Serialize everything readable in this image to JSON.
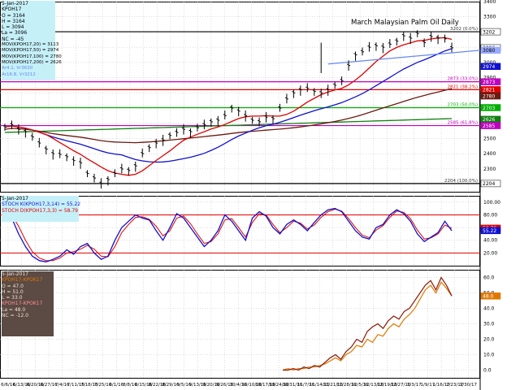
{
  "title": "March Malaysian Palm Oil Daily",
  "panel1": {
    "date": "5-Jan-2017",
    "symbol": "KPOH17",
    "open": "O = 3164",
    "high": "H = 3164",
    "low": "L = 3094",
    "last": "La = 3096",
    "net_change": "NC = -45",
    "ma_legend": [
      {
        "text": "MOV(KPOH17,20) = 3113",
        "color": "#e00000"
      },
      {
        "text": "MOV(KPOH17,50) = 2974",
        "color": "#1010d0"
      },
      {
        "text": "MOV(KPOH17,100) = 2780",
        "color": "#6b1a10"
      },
      {
        "text": "MOV(KPOH17,200) = 2626",
        "color": "#108010"
      }
    ],
    "extra_lines": [
      "Ar4.1, Vr3630",
      "Ar16.8, Vr3212"
    ]
  },
  "panel2": {
    "date": "5-Jan-2017",
    "stoch_k": "STOCH K(KPOH17,3,14) = 55.22",
    "stoch_d": "STOCH D(KPOH17,3,3) = 58.79"
  },
  "panel3": {
    "date": "5-Jan-2017",
    "lines": [
      "KPOH17-KPOK17",
      "O = 47.0",
      "H = 51.0",
      "L = 33.0",
      "KPOH17-KPOK17",
      "La = 48.0",
      "NC = -12.0"
    ]
  },
  "colors": {
    "ma20": "#e00000",
    "ma50": "#1010d0",
    "ma100": "#6b1a10",
    "ma200": "#108010",
    "stoch_k": "#1010d0",
    "stoch_d": "#e00000",
    "spread1": "#8b1a0a",
    "spread2": "#e07800",
    "trend": "#6688ee",
    "fib_magenta": "#c000c0",
    "fib_red": "#e00000",
    "fib_green": "#00b000"
  },
  "chart_data": [
    {
      "type": "line",
      "title": "March Malaysian Palm Oil Daily",
      "ylim": [
        2150,
        3400
      ],
      "y_ticks": [
        2200,
        2300,
        2400,
        2500,
        2600,
        2700,
        2800,
        2900,
        3000,
        3100,
        3200,
        3300,
        3400
      ],
      "x_labels": [
        "6/6/16",
        "6/13/16",
        "6/20/16",
        "6/27/16",
        "7/4/16",
        "7/11/16",
        "7/18/16",
        "7/25/16",
        "8/1/16",
        "8/8/16",
        "8/15/16",
        "8/22/16",
        "8/29/16",
        "9/5/16",
        "9/13/16",
        "9/20/16",
        "9/26/16",
        "10/4/16",
        "10/10/16",
        "10/17/16",
        "10/24/16",
        "10/31/16",
        "11/7/16",
        "11/14/16",
        "11/21/16",
        "11/28/16",
        "12/5/16",
        "12/13/16",
        "12/19/16",
        "12/27/16",
        "1/3/17",
        "1/9/17",
        "1/16/17",
        "1/23/17",
        "1/30/17"
      ],
      "price_close": [
        2575,
        2590,
        2560,
        2545,
        2510,
        2470,
        2430,
        2400,
        2395,
        2380,
        2355,
        2340,
        2270,
        2240,
        2205,
        2230,
        2270,
        2300,
        2290,
        2320,
        2400,
        2440,
        2470,
        2490,
        2520,
        2540,
        2560,
        2545,
        2570,
        2590,
        2610,
        2620,
        2650,
        2700,
        2680,
        2650,
        2620,
        2610,
        2640,
        2630,
        2700,
        2760,
        2800,
        2820,
        2830,
        2810,
        2800,
        2820,
        2850,
        2880,
        2980,
        3050,
        3070,
        3100,
        3110,
        3100,
        3120,
        3140,
        3175,
        3160,
        3190,
        3130,
        3170,
        3160,
        3155,
        3096
      ],
      "overlay_labels": [
        {
          "y": 3202,
          "text": "3202 (0.0%)"
        },
        {
          "y": 2873,
          "text": "2873 (33.0%)"
        },
        {
          "y": 2821,
          "text": "2821 (38.2%)"
        },
        {
          "y": 2703,
          "text": "2703 (50.0%)"
        },
        {
          "y": 2585,
          "text": "2585 (61.8%)"
        },
        {
          "y": 2204,
          "text": "2204 (100.0%)"
        }
      ],
      "value_badges": [
        {
          "y": 3202,
          "text": "3202",
          "bg": "#ffffff",
          "fg": "#000"
        },
        {
          "y": 3096,
          "text": "3096",
          "bg": "#ffffff",
          "fg": "#000"
        },
        {
          "y": 3080,
          "text": "3080",
          "bg": "#99aaff",
          "fg": "#000"
        },
        {
          "y": 2974,
          "text": "2974",
          "bg": "#1010d0",
          "fg": "#fff"
        },
        {
          "y": 2873,
          "text": "2873",
          "bg": "#c000c0",
          "fg": "#fff"
        },
        {
          "y": 2821,
          "text": "2821",
          "bg": "#e00000",
          "fg": "#fff"
        },
        {
          "y": 2780,
          "text": "2780",
          "bg": "#6b1a10",
          "fg": "#fff"
        },
        {
          "y": 2703,
          "text": "2703",
          "bg": "#00b000",
          "fg": "#fff"
        },
        {
          "y": 2626,
          "text": "2626",
          "bg": "#108010",
          "fg": "#fff"
        },
        {
          "y": 2585,
          "text": "2585",
          "bg": "#c000c0",
          "fg": "#fff"
        },
        {
          "y": 2204,
          "text": "2204",
          "bg": "#ffffff",
          "fg": "#000"
        }
      ]
    },
    {
      "type": "line",
      "title": "",
      "ylim": [
        0,
        110
      ],
      "y_ticks": [
        20.0,
        40.0,
        60.0,
        80.0,
        100.0
      ],
      "stoch_k": [
        85,
        75,
        50,
        30,
        15,
        8,
        6,
        10,
        15,
        25,
        18,
        30,
        35,
        20,
        10,
        15,
        40,
        60,
        70,
        80,
        75,
        72,
        55,
        40,
        60,
        82,
        75,
        60,
        45,
        30,
        40,
        55,
        80,
        70,
        55,
        40,
        75,
        85,
        78,
        60,
        50,
        65,
        72,
        65,
        55,
        68,
        80,
        88,
        90,
        85,
        70,
        55,
        45,
        42,
        60,
        65,
        80,
        88,
        82,
        70,
        50,
        38,
        45,
        52,
        70,
        55
      ],
      "stoch_d": [
        78,
        80,
        62,
        40,
        22,
        12,
        8,
        8,
        12,
        20,
        22,
        26,
        32,
        26,
        15,
        14,
        30,
        52,
        65,
        76,
        77,
        73,
        62,
        47,
        55,
        75,
        78,
        66,
        50,
        35,
        38,
        50,
        72,
        74,
        60,
        45,
        68,
        82,
        80,
        65,
        52,
        60,
        70,
        67,
        58,
        64,
        76,
        85,
        89,
        86,
        74,
        60,
        48,
        44,
        56,
        63,
        76,
        86,
        84,
        74,
        56,
        42,
        44,
        50,
        64,
        59
      ],
      "value_badges": [
        {
          "y": 59,
          "text": "58.79",
          "bg": "#e00000",
          "fg": "#fff"
        },
        {
          "y": 55.22,
          "text": "55.22",
          "bg": "#1010d0",
          "fg": "#fff"
        }
      ]
    },
    {
      "type": "line",
      "title": "",
      "ylim": [
        -5,
        65
      ],
      "y_ticks": [
        0.0,
        10.0,
        20.0,
        30.0,
        40.0,
        50.0,
        60.0
      ],
      "spread_a": [
        0,
        0,
        1,
        0,
        2,
        1,
        3,
        2,
        5,
        8,
        10,
        7,
        12,
        15,
        20,
        18,
        25,
        28,
        30,
        27,
        32,
        35,
        33,
        38,
        40,
        45,
        50,
        55,
        58,
        52,
        60,
        55,
        48
      ],
      "spread_b": [
        0,
        1,
        0,
        1,
        1,
        2,
        2,
        3,
        4,
        6,
        8,
        6,
        10,
        12,
        16,
        15,
        20,
        18,
        23,
        22,
        27,
        30,
        28,
        33,
        36,
        40,
        46,
        52,
        55,
        50,
        57,
        53,
        48
      ],
      "value_badges": [
        {
          "y": 48,
          "text": "48.0",
          "bg": "#e07800",
          "fg": "#fff"
        }
      ]
    }
  ]
}
